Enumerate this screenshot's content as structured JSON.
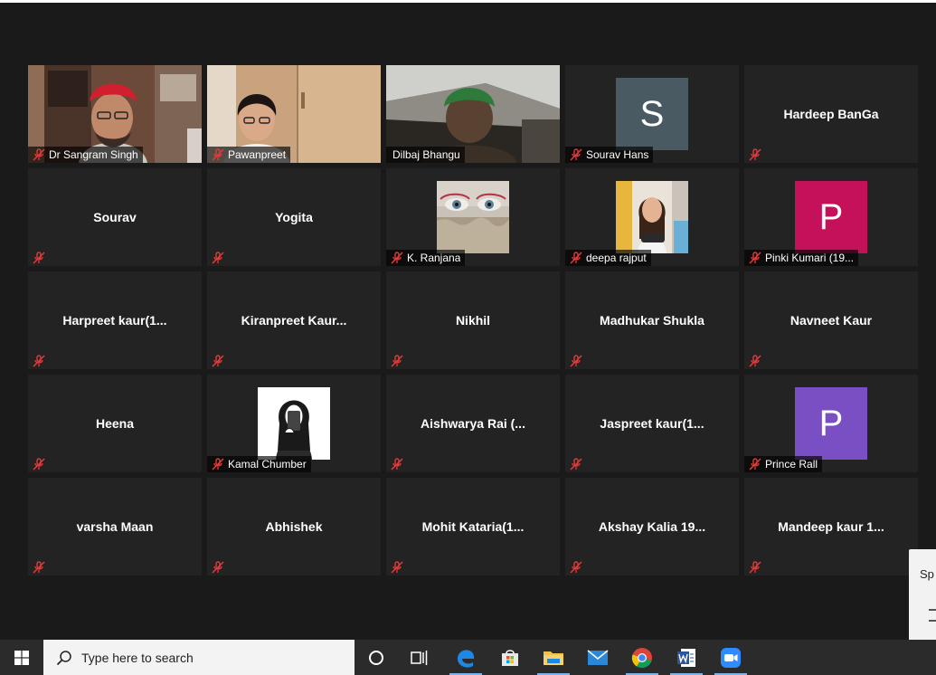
{
  "participants": [
    {
      "name": "Dr Sangram Singh",
      "video": "sangram"
    },
    {
      "name": "Pawanpreet",
      "video": "pawanpreet"
    },
    {
      "name": "Dilbaj Bhangu",
      "video": "dilbaj",
      "active": true,
      "muted": false
    },
    {
      "name": "Sourav Hans",
      "avatar_letter": "S",
      "avatar_color": "#4a5a63"
    },
    {
      "display": "Hardeep BanGa"
    },
    {
      "display": "Sourav"
    },
    {
      "display": "Yogita"
    },
    {
      "name": "K. Ranjana",
      "photo": "ranjana"
    },
    {
      "name": "deepa rajput",
      "photo": "deepa"
    },
    {
      "name": "Pinki Kumari (19...",
      "avatar_letter": "P",
      "avatar_color": "#c5105a"
    },
    {
      "display": "Harpreet  kaur(1..."
    },
    {
      "display": "Kiranpreet  Kaur..."
    },
    {
      "display": "Nikhil"
    },
    {
      "display": "Madhukar Shukla"
    },
    {
      "display": "Navneet Kaur"
    },
    {
      "display": "Heena"
    },
    {
      "name": "Kamal Chumber",
      "photo": "kamal"
    },
    {
      "display": "Aishwarya Rai (..."
    },
    {
      "display": "Jaspreet  kaur(1..."
    },
    {
      "name": "Prince Rall",
      "avatar_letter": "P",
      "avatar_color": "#7b4fc4"
    },
    {
      "display": "varsha Maan"
    },
    {
      "display": "Abhishek"
    },
    {
      "display": "Mohit  Kataria(1..."
    },
    {
      "display": "Akshay  Kalia  19..."
    },
    {
      "display": "Mandeep  kaur  1..."
    }
  ],
  "side_panel": {
    "text": "Sp"
  },
  "taskbar": {
    "search_placeholder": "Type here to search",
    "apps": [
      "task-view",
      "edge",
      "store",
      "file-explorer",
      "mail",
      "chrome",
      "word",
      "zoom"
    ]
  },
  "colors": {
    "active_speaker": "#b9d865",
    "muted_mic": "#e23b3b",
    "tile": "#232323",
    "background": "#1a1a1a"
  }
}
